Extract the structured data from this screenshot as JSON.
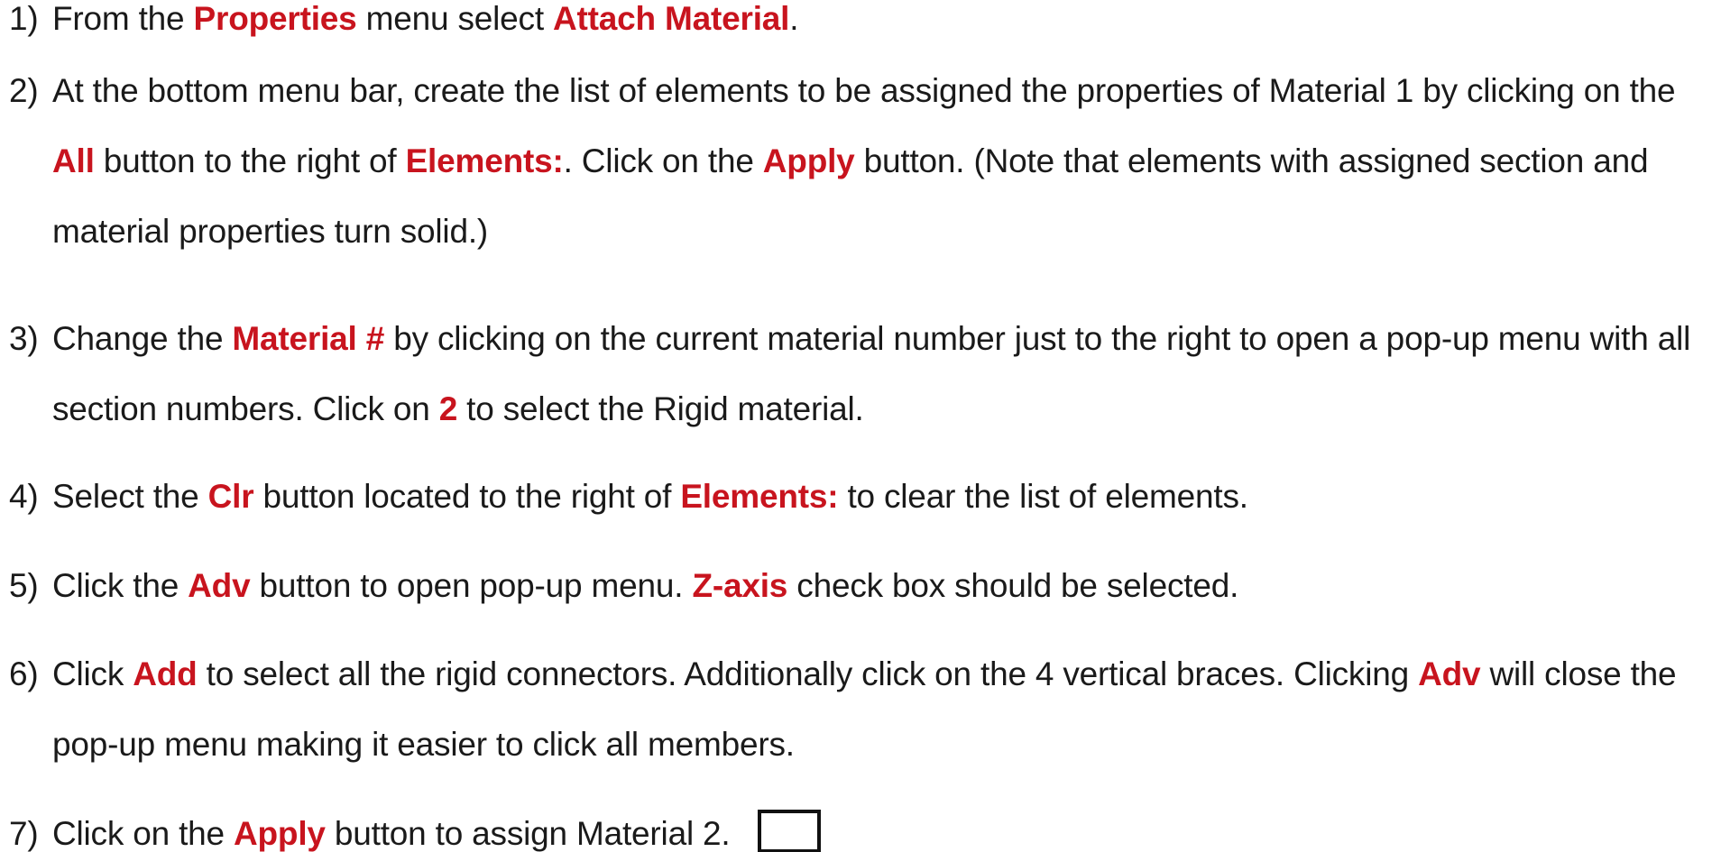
{
  "steps": [
    {
      "number": "1)",
      "parts": [
        {
          "t": "From the ",
          "h": false
        },
        {
          "t": "Properties",
          "h": true
        },
        {
          "t": " menu select ",
          "h": false
        },
        {
          "t": "Attach Material",
          "h": true
        },
        {
          "t": ".",
          "h": false
        }
      ]
    },
    {
      "number": "2)",
      "parts": [
        {
          "t": "At the bottom menu bar, create the list of elements to be assigned the properties of Material 1 by clicking on the ",
          "h": false
        },
        {
          "t": "All",
          "h": true
        },
        {
          "t": " button to the right of ",
          "h": false
        },
        {
          "t": "Elements:",
          "h": true
        },
        {
          "t": ". Click on the ",
          "h": false
        },
        {
          "t": "Apply",
          "h": true
        },
        {
          "t": " button. (Note that elements with assigned section and material properties turn solid.)",
          "h": false
        }
      ]
    },
    {
      "number": "3)",
      "parts": [
        {
          "t": "Change the ",
          "h": false
        },
        {
          "t": "Material #",
          "h": true
        },
        {
          "t": " by clicking on the current material number just to the right to open a pop-up menu with all section numbers. Click on ",
          "h": false
        },
        {
          "t": "2",
          "h": true
        },
        {
          "t": " to select the Rigid material.",
          "h": false
        }
      ]
    },
    {
      "number": "4)",
      "parts": [
        {
          "t": "Select the ",
          "h": false
        },
        {
          "t": "Clr",
          "h": true
        },
        {
          "t": " button located to the right of ",
          "h": false
        },
        {
          "t": "Elements:",
          "h": true
        },
        {
          "t": " to clear the list of elements.",
          "h": false
        }
      ]
    },
    {
      "number": "5)",
      "parts": [
        {
          "t": "Click the ",
          "h": false
        },
        {
          "t": "Adv",
          "h": true
        },
        {
          "t": " button to open pop-up menu. ",
          "h": false
        },
        {
          "t": "Z-axis",
          "h": true
        },
        {
          "t": " check box should be selected.",
          "h": false
        }
      ]
    },
    {
      "number": "6)",
      "parts": [
        {
          "t": "Click ",
          "h": false
        },
        {
          "t": "Add",
          "h": true
        },
        {
          "t": " to select all the rigid connectors. Additionally click on the 4 vertical braces. Clicking ",
          "h": false
        },
        {
          "t": "Adv",
          "h": true
        },
        {
          "t": " will close the pop-up menu making it easier to click all members.",
          "h": false
        }
      ]
    },
    {
      "number": "7)",
      "parts": [
        {
          "t": "Click on the ",
          "h": false
        },
        {
          "t": "Apply",
          "h": true
        },
        {
          "t": " button to assign Material 2.",
          "h": false
        }
      ],
      "checkbox": true
    }
  ],
  "colors": {
    "highlight": "#c8141e",
    "text": "#1a1a1a"
  }
}
